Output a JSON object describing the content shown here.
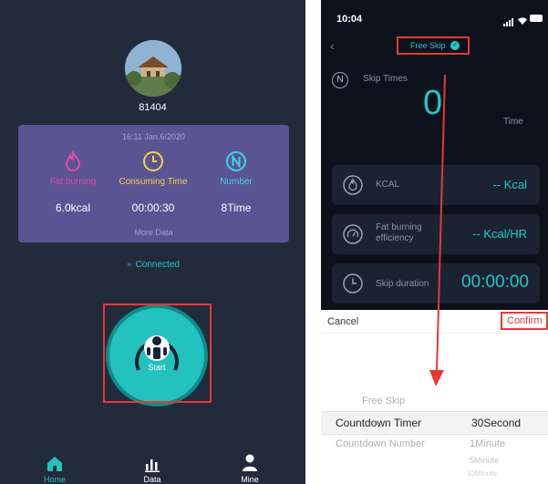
{
  "left_screen": {
    "username": "81404",
    "stats_card": {
      "date": "16:11 Jan.6/2020",
      "columns": [
        {
          "label": "Fat burning",
          "value": "6.0kcal",
          "icon": "flame-icon",
          "color": "#e24aa6"
        },
        {
          "label": "Consuming Time",
          "value": "00:00:30",
          "icon": "clock-icon",
          "color": "#f0d050"
        },
        {
          "label": "Number",
          "value": "8Time",
          "icon": "letter-n-icon",
          "color": "#3ad6e6"
        }
      ],
      "more_data": "More Data"
    },
    "connection_status": "Connected",
    "start_label": "Start",
    "bottom_nav": [
      {
        "label": "Home",
        "icon": "home-icon"
      },
      {
        "label": "Data",
        "icon": "bar-chart-icon"
      },
      {
        "label": "Mine",
        "icon": "person-icon"
      }
    ]
  },
  "right_screen": {
    "status_bar": {
      "time": "10:04"
    },
    "header": {
      "mode_title": "Free Skip"
    },
    "skip_times": {
      "label": "Skip Times",
      "value": "0",
      "unit": "Time"
    },
    "metrics": [
      {
        "label": "KCAL",
        "value": "-- Kcal",
        "icon": "flame-icon"
      },
      {
        "label": "Fat burning efficiency",
        "value": "-- Kcal/HR",
        "icon": "gauge-icon"
      },
      {
        "label": "Skip duration",
        "value": "00:00:00",
        "icon": "clock-icon"
      }
    ],
    "picker": {
      "cancel": "Cancel",
      "confirm": "Confirm",
      "modes": [
        "Free Skip",
        "Countdown Timer",
        "Countdown Number"
      ],
      "values": [
        "30Second",
        "1Minute",
        "5Minute",
        "10Minute"
      ]
    }
  },
  "colors": {
    "accent": "#22c9c5",
    "highlight": "#e53935",
    "card_purple": "#5b5493"
  }
}
